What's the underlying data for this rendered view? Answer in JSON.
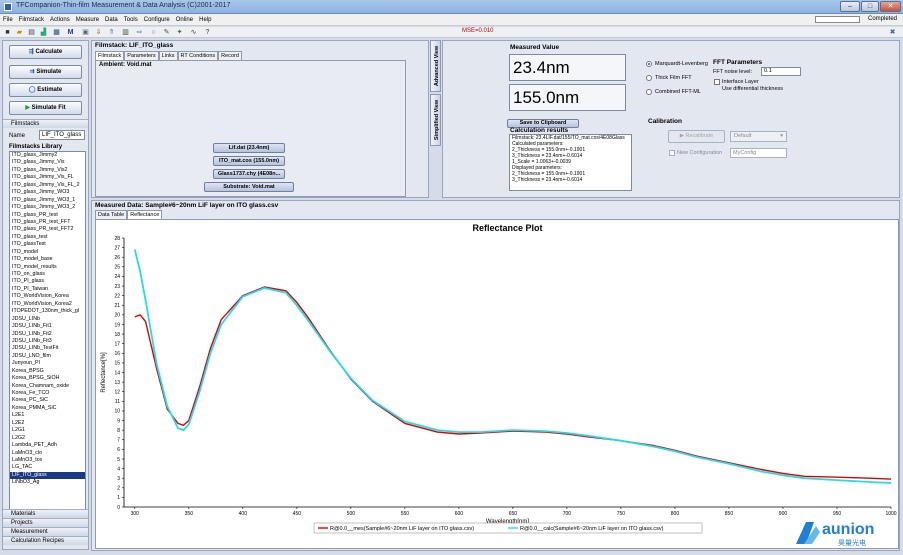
{
  "window": {
    "title": "TFCompanion-Thin-film Measurement & Data Analysis (C)2001-2017",
    "buttons": [
      "–",
      "□",
      "✕"
    ]
  },
  "menu": [
    "File",
    "Filmstack",
    "Actions",
    "Measure",
    "Data",
    "Tools",
    "Configure",
    "Online",
    "Help"
  ],
  "status": {
    "text": "Completed"
  },
  "toolbar": {
    "mse": "MSE=0.010",
    "icons": [
      "save-icon",
      "open-icon",
      "print-icon",
      "chart-icon",
      "grid-icon",
      "m-icon",
      "calc-icon",
      "filter-icon",
      "list-icon",
      "table-icon",
      "arrow-icon",
      "circle-icon",
      "wrench-icon",
      "settings-icon",
      "graph-icon",
      "help-icon"
    ]
  },
  "left": {
    "buttons": {
      "calculate": "Calculate",
      "simulate": "Simulate",
      "estimate": "Estimate",
      "simulate_fit": "Simulate Fit"
    },
    "filmstacks_section": "Filmstacks",
    "name_label": "Name",
    "name_value": "LIF_ITO_glass",
    "library_title": "Filmstacks Library",
    "library": [
      "ITO_glass_Jimmy2",
      "ITO_glass_Jimmy_Vis",
      "ITO_glass_Jimmy_Vis2",
      "ITO_glass_Jimmy_Vis_FL",
      "ITO_glass_Jimmy_Vis_FL_2",
      "ITO_glass_Jimmy_WO3",
      "ITO_glass_Jimmy_WO3_1",
      "ITO_glass_Jimmy_WO3_2",
      "ITO_glass_PR_test",
      "ITO_glass_PR_test_FFT",
      "ITO_glass_PR_test_FFT2",
      "ITO_glass_test",
      "ITO_glassTest",
      "ITO_model",
      "ITO_model_base",
      "ITO_model_results",
      "ITO_on_glass",
      "ITO_PI_glass",
      "ITO_PI_Taiwan",
      "ITO_WorldVision_Korea",
      "ITO_WorldVision_Korea2",
      "ITOPEDOT_130nm_thick_gl",
      "JDSU_LINb",
      "JDSU_LINb_Fit1",
      "JDSU_LINb_Fit2",
      "JDSU_LINb_Fit3",
      "JDSU_LINb_TestFit",
      "JDSU_LNO_film",
      "Junyoun_PI",
      "Korea_BPSG",
      "Korea_BPSG_SiOH",
      "Korea_Chamnam_oxide",
      "Korea_Fe_TCO",
      "Korea_PC_SiC",
      "Korea_PMMA_SiC",
      "L2E1",
      "L2E2",
      "L2G1",
      "L2G2",
      "Lambda_PET_Adh",
      "LaMnO3_clo",
      "LaMnO3_tox",
      "LG_TAC",
      "LIF_ITO_glass",
      "LiNbO3_Ag"
    ],
    "selected_index": 43,
    "bottom_sections": [
      "Materials",
      "Projects",
      "Measurement",
      "Calculation Recipes"
    ]
  },
  "filmstack": {
    "title": "Filmstack: LIF_ITO_glass",
    "tabs": [
      "Filmstack",
      "Parameters",
      "Links",
      "RT Conditions",
      "Record"
    ],
    "ambient": "Ambient: Void.mat",
    "layers": [
      "Lif.dat (23.4nm)",
      "ITO_mat.cos (155.0nm)",
      "Glass1737.chy (4E08n...",
      "Substrate: Void.mat"
    ],
    "vtabs": [
      "Advanced View",
      "Simplified View"
    ]
  },
  "measured": {
    "title": "Measured Value",
    "value1": "23.4nm",
    "value2": "155.0nm",
    "clipboard": "Save to Clipboard",
    "calc_title": "Calculation results",
    "calc_lines": [
      "Filmstack: 23.4LIF.dat/155ITO_mat.cos/4E08Glass",
      "Calculated parameters:",
      "2_Thickness = 155.0nm+-0.1901",
      "3_Thickness = 23.4nm+-0.6014",
      "1_Scale = 1.0063+-0.0039",
      "Displayed parameters:",
      "2_Thickness = 155.0nm+-0.1901",
      "3_Thickness = 23.4nm+-0.6014"
    ],
    "methods": [
      "Marquardt-Levenberg",
      "Thick Film FFT",
      "Combined FFT-ML"
    ],
    "fft_title": "FFT Parameters",
    "fft_noise_label": "FFT noise level:",
    "fft_noise_value": "0.1",
    "interface_layer": "Interface Layer",
    "diff_thickness": "Use differential thickness",
    "calibration_title": "Calibration",
    "recalibrate": "Recalibrate",
    "default_option": "Default",
    "new_config": "New Configuration",
    "config_name": "MyConfig"
  },
  "plot_panel": {
    "title": "Measured Data: Sample#6~20nm LiF layer on ITO glass.csv",
    "tabs": [
      "Data Table",
      "Reflectance"
    ]
  },
  "chart_data": {
    "type": "line",
    "title": "Reflectance Plot",
    "xlabel": "Wavelength[nm]",
    "ylabel": "Reflectance[%]",
    "xlim": [
      290,
      1000
    ],
    "ylim": [
      0,
      28
    ],
    "xticks": [
      300,
      350,
      400,
      450,
      500,
      550,
      600,
      650,
      700,
      750,
      800,
      850,
      900,
      950,
      1000
    ],
    "yticks": [
      0,
      1,
      2,
      3,
      4,
      5,
      6,
      7,
      8,
      9,
      10,
      11,
      12,
      13,
      14,
      15,
      16,
      17,
      18,
      19,
      20,
      21,
      22,
      23,
      24,
      25,
      26,
      27,
      28
    ],
    "grid": false,
    "legend": "bottom-center",
    "series": [
      {
        "name": "R@0.0__mes(Sample#6~20nm LiF layer on ITO glass.csv)",
        "color": "#e00000",
        "x": [
          300,
          305,
          310,
          320,
          330,
          340,
          345,
          350,
          360,
          370,
          380,
          400,
          420,
          440,
          450,
          460,
          480,
          500,
          520,
          550,
          580,
          600,
          620,
          650,
          680,
          700,
          720,
          750,
          780,
          800,
          820,
          850,
          880,
          900,
          920,
          950,
          980,
          1000
        ],
        "y": [
          19.8,
          20.0,
          19.3,
          14.5,
          10.2,
          8.7,
          8.5,
          9.0,
          12.5,
          16.5,
          19.5,
          22.0,
          22.9,
          22.5,
          21.3,
          19.8,
          16.4,
          13.3,
          11.0,
          8.7,
          7.8,
          7.6,
          7.7,
          7.9,
          7.8,
          7.6,
          7.3,
          6.9,
          6.4,
          5.9,
          5.3,
          4.6,
          3.9,
          3.5,
          3.2,
          3.1,
          3.0,
          2.9
        ]
      },
      {
        "name": "R@0.0__calc(Sample#6~20nm LiF layer on ITO glass.csv)",
        "color": "#22dde8",
        "x": [
          300,
          305,
          310,
          320,
          330,
          340,
          345,
          350,
          360,
          370,
          380,
          400,
          420,
          440,
          450,
          460,
          480,
          500,
          520,
          550,
          580,
          600,
          620,
          650,
          680,
          700,
          720,
          750,
          780,
          800,
          820,
          850,
          880,
          900,
          920,
          950,
          980,
          1000
        ],
        "y": [
          26.8,
          24.5,
          21.5,
          15.0,
          10.5,
          8.2,
          8.0,
          8.6,
          12.0,
          16.0,
          19.0,
          21.9,
          22.8,
          22.3,
          21.0,
          19.5,
          16.3,
          13.4,
          11.1,
          8.9,
          8.0,
          7.8,
          7.8,
          8.0,
          7.9,
          7.7,
          7.4,
          6.9,
          6.3,
          5.8,
          5.2,
          4.5,
          3.7,
          3.3,
          3.0,
          2.8,
          2.6,
          2.5
        ]
      }
    ]
  },
  "logo": {
    "name": "aunion",
    "sub": "昊量光电"
  }
}
